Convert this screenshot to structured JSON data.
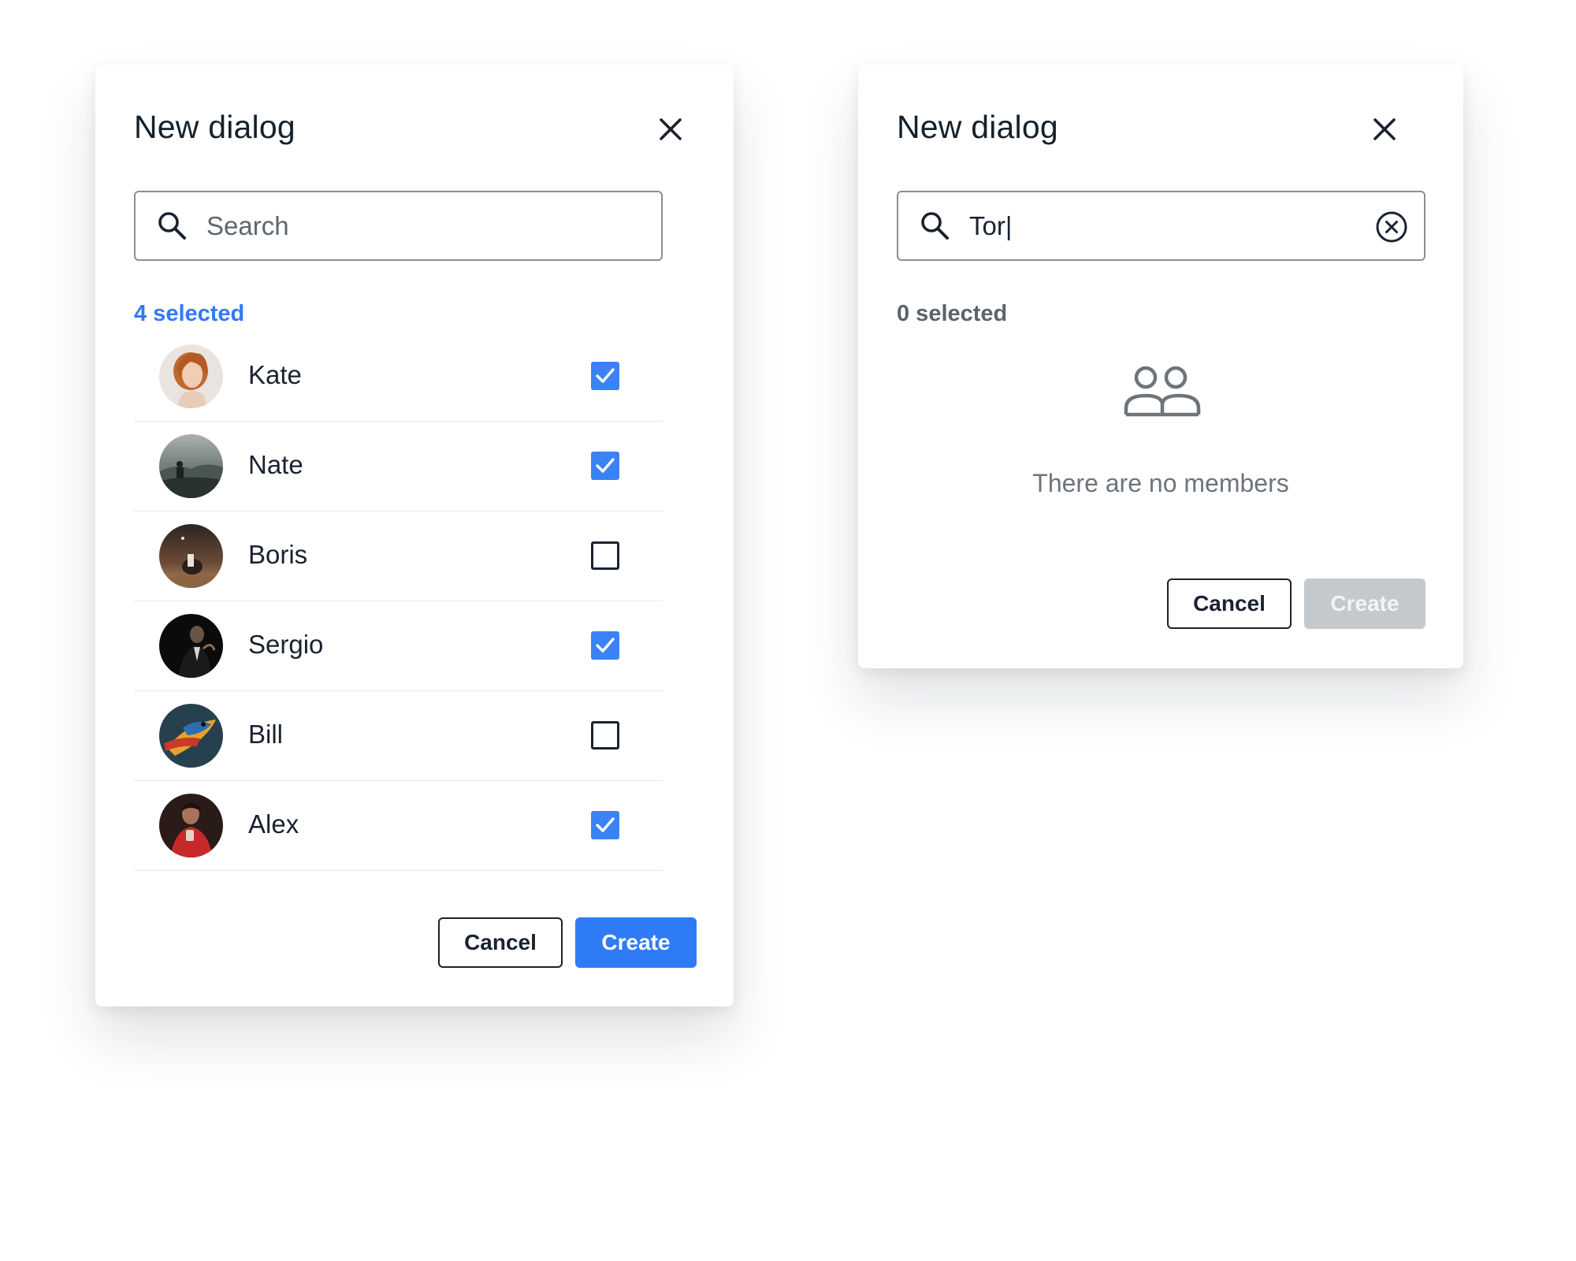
{
  "dialogs": {
    "left": {
      "title": "New dialog",
      "search": {
        "placeholder": "Search",
        "value": ""
      },
      "selected_label": "4 selected",
      "members": [
        {
          "name": "Kate",
          "checked": true,
          "avatar": "avatar-photo"
        },
        {
          "name": "Nate",
          "checked": true,
          "avatar": "avatar-photo"
        },
        {
          "name": "Boris",
          "checked": false,
          "avatar": "avatar-photo"
        },
        {
          "name": "Sergio",
          "checked": true,
          "avatar": "avatar-photo"
        },
        {
          "name": "Bill",
          "checked": false,
          "avatar": "avatar-photo"
        },
        {
          "name": "Alex",
          "checked": true,
          "avatar": "avatar-photo"
        }
      ],
      "cancel_label": "Cancel",
      "create_label": "Create",
      "create_enabled": true
    },
    "right": {
      "title": "New dialog",
      "search": {
        "value": "Tor|"
      },
      "selected_label": "0 selected",
      "empty_message": "There are no members",
      "cancel_label": "Cancel",
      "create_label": "Create",
      "create_enabled": false
    }
  },
  "icons": {
    "close": "close-icon",
    "search": "search-icon",
    "clear": "clear-circle-icon",
    "checkmark": "check-icon",
    "empty_state": "people-group-icon"
  },
  "colors": {
    "accent": "#2f7bf6",
    "checkbox_checked": "#3b82f6",
    "text_primary": "#1a2230",
    "text_muted": "#6d747b",
    "disabled_button": "#c4c9ce",
    "divider": "#e3e9f0"
  }
}
